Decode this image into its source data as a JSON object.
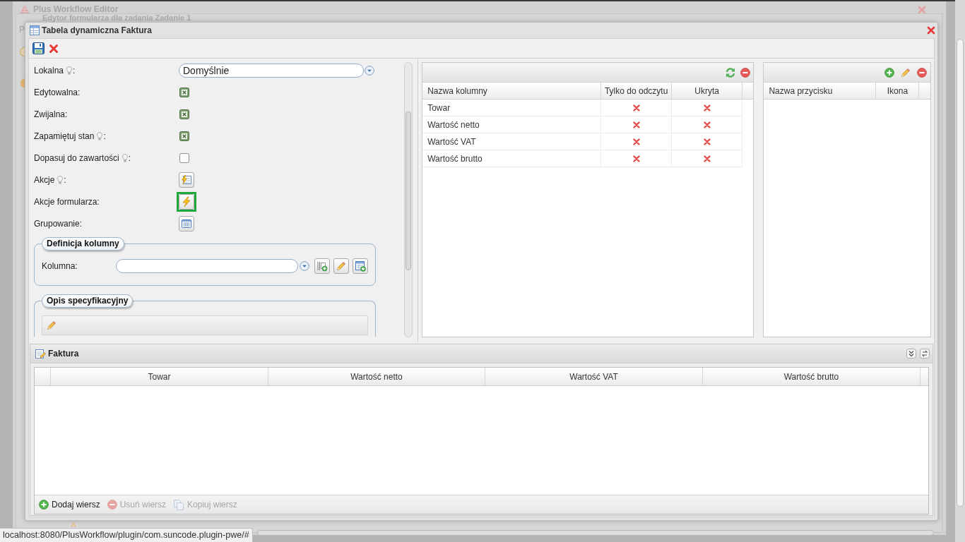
{
  "background": {
    "app_title": "Plus Workflow Editor",
    "editor_title": "Edytor formularza dla zadania Zadanie 1",
    "tab_label": "P"
  },
  "dialog": {
    "title": "Tabela dynamiczna Faktura"
  },
  "form": {
    "fields": [
      {
        "kind": "combo",
        "label": "Lokalna",
        "hint": true,
        "suffix": ":",
        "value": "Domyślnie",
        "highlighted": false
      },
      {
        "kind": "checkbox",
        "label": "Edytowalna:",
        "hint": false,
        "checked": true,
        "highlighted": false
      },
      {
        "kind": "checkbox",
        "label": "Zwijalna:",
        "hint": false,
        "checked": true,
        "highlighted": false
      },
      {
        "kind": "checkbox",
        "label": "Zapamiętuj stan",
        "hint": true,
        "suffix": ":",
        "checked": true,
        "highlighted": false
      },
      {
        "kind": "checkbox",
        "label": "Dopasuj do zawartości",
        "hint": true,
        "suffix": ":",
        "checked": false,
        "highlighted": false
      },
      {
        "kind": "actions",
        "label": "Akcje",
        "hint": true,
        "suffix": ":",
        "highlighted": false
      },
      {
        "kind": "bolt",
        "label": "Akcje formularza:",
        "hint": false,
        "highlighted": true
      },
      {
        "kind": "list",
        "label": "Grupowanie:",
        "hint": false,
        "highlighted": false
      }
    ]
  },
  "column_definition": {
    "legend": "Definicja kolumny",
    "label": "Kolumna:"
  },
  "specification": {
    "legend": "Opis specyfikacyjny"
  },
  "columns_grid": {
    "columns": [
      "Nazwa kolumny",
      "Tylko do odczytu",
      "Ukryta"
    ],
    "rows": [
      {
        "name": "Towar",
        "read_only": false,
        "hidden": false
      },
      {
        "name": "Wartość netto",
        "read_only": false,
        "hidden": false
      },
      {
        "name": "Wartość VAT",
        "read_only": false,
        "hidden": false
      },
      {
        "name": "Wartość brutto",
        "read_only": false,
        "hidden": false
      }
    ]
  },
  "buttons_grid": {
    "columns": [
      "Nazwa przycisku",
      "Ikona"
    ]
  },
  "preview": {
    "title": "Faktura",
    "columns": [
      "Towar",
      "Wartość netto",
      "Wartość VAT",
      "Wartość brutto"
    ],
    "actions": [
      {
        "kind": "add",
        "label": "Dodaj wiersz",
        "disabled": false
      },
      {
        "kind": "remove",
        "label": "Usuń wiersz",
        "disabled": true
      },
      {
        "kind": "copy",
        "label": "Kopiuj wiersz",
        "disabled": true
      }
    ]
  },
  "status_bar": {
    "url": "localhost:8080/PlusWorkflow/plugin/com.suncode.plugin-pwe/#"
  }
}
